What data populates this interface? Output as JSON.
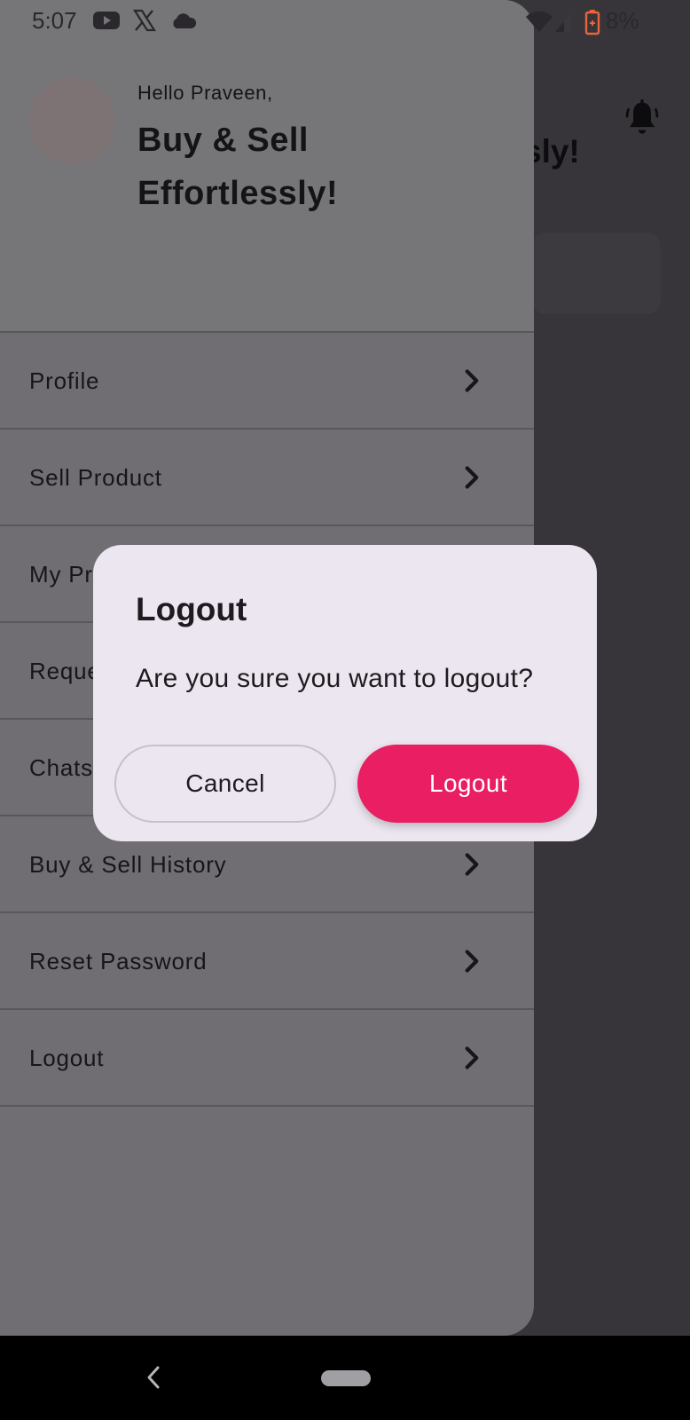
{
  "status_bar": {
    "time": "5:07",
    "battery": "8%",
    "icons": [
      "youtube-icon",
      "x-icon",
      "cloud-icon",
      "wifi-icon",
      "signal-icon",
      "battery-icon"
    ]
  },
  "background": {
    "headline_fragment": "sly!",
    "icons": [
      "bell-icon"
    ]
  },
  "drawer": {
    "greeting": "Hello Praveen,",
    "tagline": "Buy & Sell Effortlessly!",
    "menu": [
      {
        "label": "Profile"
      },
      {
        "label": "Sell Product"
      },
      {
        "label": "My Pr"
      },
      {
        "label": "Reque"
      },
      {
        "label": "Chats"
      },
      {
        "label": "Buy & Sell History"
      },
      {
        "label": "Reset Password"
      },
      {
        "label": "Logout"
      }
    ]
  },
  "dialog": {
    "title": "Logout",
    "message": "Are you sure you want to logout?",
    "cancel_label": "Cancel",
    "confirm_label": "Logout"
  },
  "colors": {
    "accent": "#e91e63",
    "dialog_bg": "#ece6f0",
    "battery_low": "#e8643c"
  }
}
